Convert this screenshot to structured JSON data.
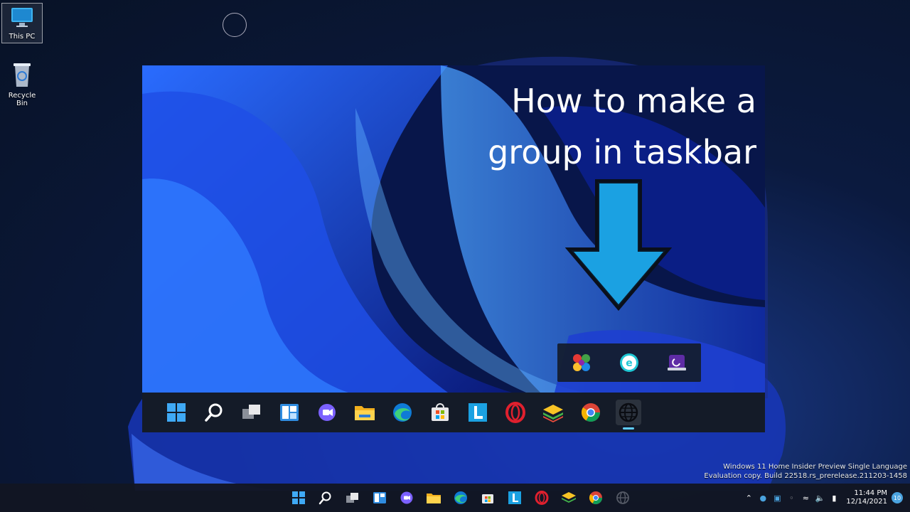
{
  "desktop": {
    "icons": [
      {
        "label": "This PC"
      },
      {
        "label": "Recycle Bin"
      }
    ]
  },
  "headline": {
    "line1": "How to make a",
    "line2": "group in taskbar"
  },
  "colors": {
    "accent": "#1ba1e2",
    "taskbar": "#161c28",
    "indicator": "#60cdff"
  },
  "group_popup": {
    "icons": [
      "multicolor-app-icon",
      "eset-icon",
      "cleaner-app-icon"
    ]
  },
  "inner_taskbar": {
    "icons": [
      "windows-start-icon",
      "search-icon",
      "task-view-icon",
      "widgets-icon",
      "teams-chat-icon",
      "file-explorer-icon",
      "edge-icon",
      "store-icon",
      "l-app-icon",
      "opera-icon",
      "bluestacks-icon",
      "chrome-icon",
      "globe-group-icon"
    ]
  },
  "watermark": {
    "line1": "Windows 11 Home Insider Preview Single Language",
    "line2": "Evaluation copy. Build 22518.rs_prerelease.211203-1458"
  },
  "tray": {
    "time": "11:44 PM",
    "date": "12/14/2021",
    "notifications": "10"
  }
}
